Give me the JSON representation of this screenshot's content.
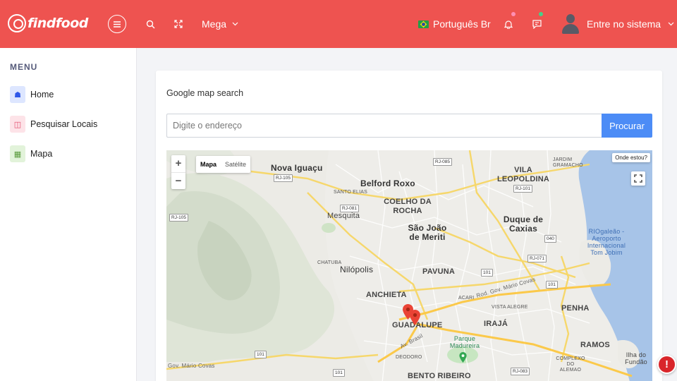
{
  "app": {
    "brand": "findfood"
  },
  "header": {
    "mega_label": "Mega",
    "language_label": "Português Br",
    "user_label": "Entre no sistema",
    "accent_color": "#ee5350"
  },
  "sidebar": {
    "menu_title": "MENU",
    "items": [
      {
        "label": "Home",
        "icon": "home-icon"
      },
      {
        "label": "Pesquisar Locais",
        "icon": "map-search-icon"
      },
      {
        "label": "Mapa",
        "icon": "map-icon"
      }
    ]
  },
  "main": {
    "card_title": "Google map search",
    "address_placeholder": "Digite o endereço",
    "address_value": "",
    "search_button": "Procurar",
    "button_color": "#4c8cf6"
  },
  "map": {
    "zoom_in": "+",
    "zoom_out": "−",
    "type_map": "Mapa",
    "type_satellite": "Satélite",
    "where_am_i": "Onde estou?",
    "labels": {
      "nova_iguacu": "Nova Iguaçu",
      "belford_roxo": "Belford Roxo",
      "vila_leopoldina": "VILA LEOPOLDINA",
      "jardim_gramacho": "JARDIM GRAMACHO",
      "santo_elias": "SANTO ELIAS",
      "coelho_da_rocha": "COELHO DA ROCHA",
      "mesquita": "Mesquita",
      "sao_joao_de_meriti": "São João de Meriti",
      "duque_de_caxias": "Duque de Caxias",
      "galeao": "RIOgaleão - Aeroporto Internacional Tom Jobim",
      "chatuba": "CHATUBA",
      "nilopolis": "Nilópolis",
      "pavuna": "PAVUNA",
      "anchieta": "ANCHIETA",
      "acari": "ACARI",
      "vista_alegre": "VISTA ALEGRE",
      "penha": "PENHA",
      "guadalupe": "GUADALUPE",
      "iraja": "IRAJÁ",
      "parque_madureira": "Parque Madureira",
      "ramos": "RAMOS",
      "deodoro": "DEODORO",
      "bento_ribeiro": "BENTO RIBEIRO",
      "complexo_alemao": "COMPLEXO DO ALEMAO",
      "ilha_do_fundao": "Ilha do Fundão",
      "av_brasil": "Av. Brasil",
      "rod_mario_covas": "Rod. Gov. Mário Covas",
      "mario_covas_left": "Gov. Mário Covas"
    },
    "shields": {
      "rj085": "RJ-085",
      "rj105a": "RJ-105",
      "rj105b": "RJ-105",
      "rj081": "RJ-081",
      "rj101": "RJ-101",
      "br040": "040",
      "rj071": "RJ-071",
      "br101a": "101",
      "br101b": "101",
      "br101c": "101",
      "br101d": "101",
      "rj083": "RJ-083"
    },
    "pins": 2
  }
}
